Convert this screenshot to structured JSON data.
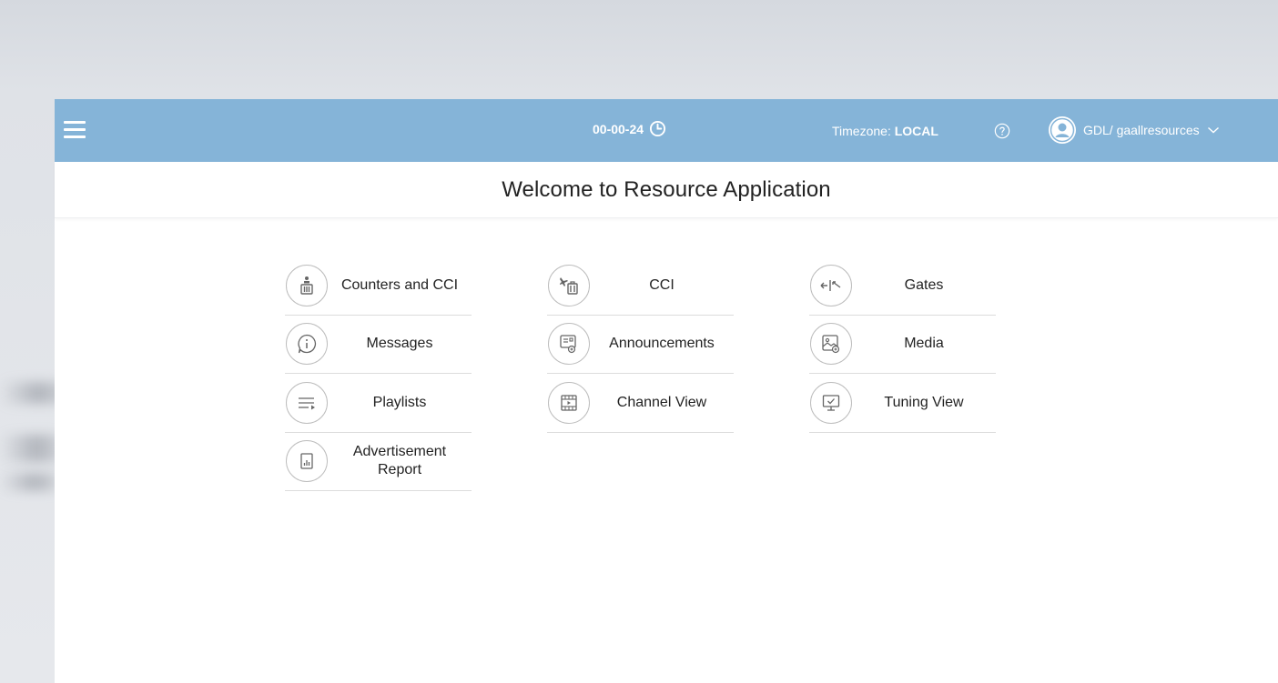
{
  "header": {
    "menu_icon": "hamburger-icon",
    "date": "00-00-24",
    "clock_icon": "clock-icon",
    "timezone_label": "Timezone: ",
    "timezone_value": "LOCAL",
    "help_icon": "help-circle-icon",
    "user_label": "GDL/ gaallresources",
    "user_icon": "user-avatar-icon",
    "bar_color": "#85b4d8"
  },
  "page": {
    "title": "Welcome to Resource Application"
  },
  "tiles": [
    {
      "label": "Counters and CCI",
      "icon": "counter-person-icon"
    },
    {
      "label": "CCI",
      "icon": "plane-luggage-icon"
    },
    {
      "label": "Gates",
      "icon": "gate-arrow-icon"
    },
    {
      "label": "Messages",
      "icon": "info-bubble-icon"
    },
    {
      "label": "Announcements",
      "icon": "announcement-board-icon"
    },
    {
      "label": "Media",
      "icon": "image-media-icon"
    },
    {
      "label": "Playlists",
      "icon": "playlist-icon"
    },
    {
      "label": "Channel View",
      "icon": "film-channel-icon"
    },
    {
      "label": "Tuning View",
      "icon": "monitor-check-icon"
    },
    {
      "label": "Advertisement Report",
      "icon": "report-chart-icon"
    }
  ]
}
